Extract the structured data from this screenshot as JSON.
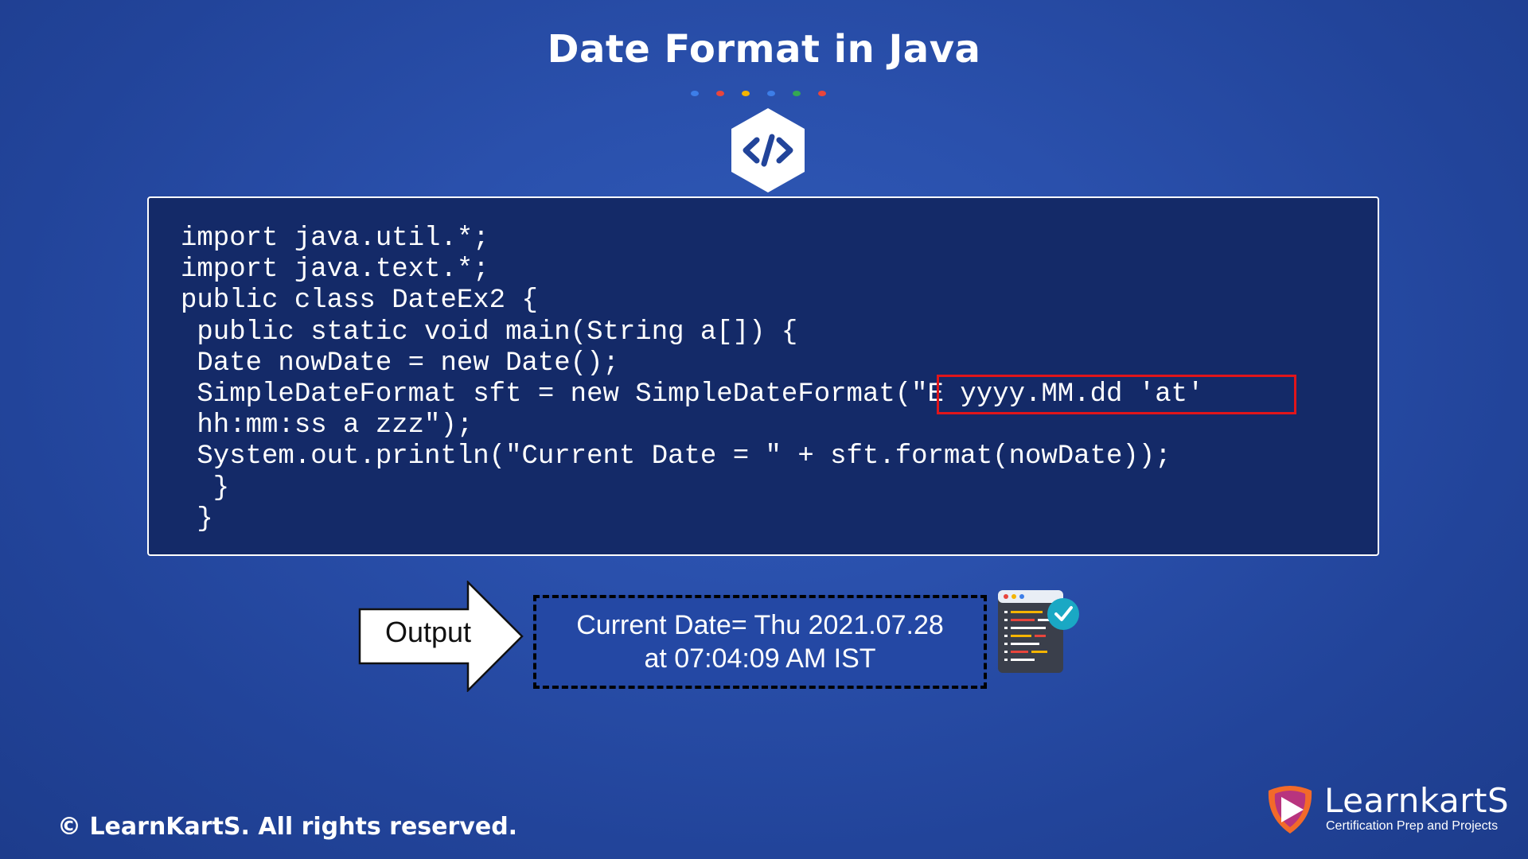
{
  "title": "Date Format in Java",
  "dot_colors": [
    "#3d7ee8",
    "#e8453c",
    "#f4b400",
    "#3d7ee8",
    "#34a853",
    "#e8453c"
  ],
  "code_icon": "code-brackets-icon",
  "code_lines": [
    "import java.util.*;",
    "import java.text.*;",
    "public class DateEx2 {",
    " public static void main(String a[]) {",
    " Date nowDate = new Date();",
    " SimpleDateFormat sft = new SimpleDateFormat(\"E yyyy.MM.dd 'at'",
    " hh:mm:ss a zzz\");",
    " System.out.println(\"Current Date = \" + sft.format(nowDate));",
    "  }",
    " }"
  ],
  "highlight_color": "#e0151b",
  "output": {
    "label": "Output",
    "line1": "Current Date= Thu 2021.07.28",
    "line2": "at 07:04:09 AM IST"
  },
  "editor_icon": "code-editor-check-icon",
  "copyright": "© LearnKartS. All rights reserved.",
  "logo": {
    "name": "LearnkartS",
    "tagline": "Certification Prep and Projects"
  }
}
